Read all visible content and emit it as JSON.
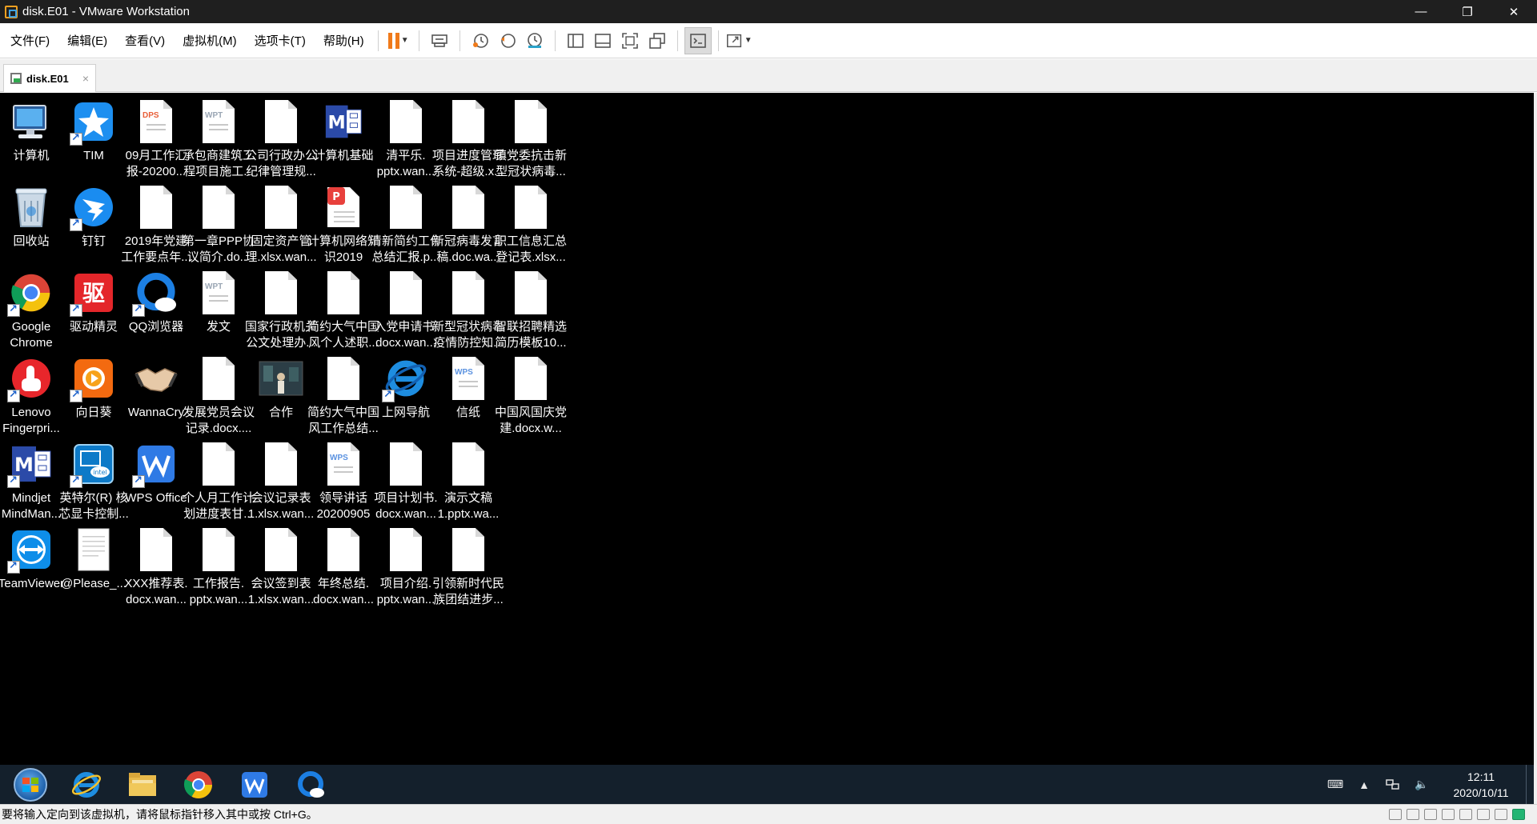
{
  "window": {
    "title": "disk.E01 - VMware Workstation",
    "controls": {
      "minimize": "—",
      "restore": "❐",
      "close": "✕"
    }
  },
  "menu": [
    {
      "label": "文件(F)"
    },
    {
      "label": "编辑(E)"
    },
    {
      "label": "查看(V)"
    },
    {
      "label": "虚拟机(M)"
    },
    {
      "label": "选项卡(T)"
    },
    {
      "label": "帮助(H)"
    }
  ],
  "tab": {
    "label": "disk.E01",
    "close": "×"
  },
  "desktop_icons": [
    {
      "label": "计算机",
      "icon": "computer-icon",
      "shortcut": false
    },
    {
      "label": "TIM",
      "icon": "tim-icon",
      "shortcut": true
    },
    {
      "label": "09月工作汇\n报-20200...",
      "icon": "dps-doc-icon",
      "shortcut": false,
      "doc_tag": "DPS"
    },
    {
      "label": "承包商建筑工\n程项目施工...",
      "icon": "wpt-doc-icon",
      "shortcut": false,
      "doc_tag": "WPT"
    },
    {
      "label": "公司行政办公\n纪律管理规...",
      "icon": "blank-doc-icon",
      "shortcut": false
    },
    {
      "label": "计算机基础",
      "icon": "mindjet-doc-icon",
      "shortcut": false
    },
    {
      "label": "清平乐.\npptx.wan...",
      "icon": "blank-doc-icon",
      "shortcut": false
    },
    {
      "label": "项目进度管理\n系统-超级.x...",
      "icon": "blank-doc-icon",
      "shortcut": false
    },
    {
      "label": "镇党委抗击新\n型冠状病毒...",
      "icon": "blank-doc-icon",
      "shortcut": false
    },
    {
      "label": "回收站",
      "icon": "recycle-bin-icon",
      "shortcut": false
    },
    {
      "label": "钉钉",
      "icon": "dingtalk-icon",
      "shortcut": true
    },
    {
      "label": "2019年党建\n工作要点年...",
      "icon": "blank-doc-icon",
      "shortcut": false
    },
    {
      "label": "第一章PPP协\n议简介.do...",
      "icon": "blank-doc-icon",
      "shortcut": false
    },
    {
      "label": "固定资产管\n理.xlsx.wan...",
      "icon": "blank-doc-icon",
      "shortcut": false
    },
    {
      "label": "计算机网络知\n识2019",
      "icon": "wps-pdf-doc-icon",
      "shortcut": false
    },
    {
      "label": "清新简约工作\n总结汇报.p...",
      "icon": "blank-doc-icon",
      "shortcut": false
    },
    {
      "label": "新冠病毒发言\n稿.doc.wa...",
      "icon": "blank-doc-icon",
      "shortcut": false
    },
    {
      "label": "职工信息汇总\n登记表.xlsx...",
      "icon": "blank-doc-icon",
      "shortcut": false
    },
    {
      "label": "Google\nChrome",
      "icon": "chrome-icon",
      "shortcut": true
    },
    {
      "label": "驱动精灵",
      "icon": "driver-genius-icon",
      "shortcut": true
    },
    {
      "label": "QQ浏览器",
      "icon": "qq-browser-icon",
      "shortcut": true
    },
    {
      "label": "发文",
      "icon": "wpt-doc-icon",
      "shortcut": false,
      "doc_tag": "WPT"
    },
    {
      "label": "国家行政机关\n公文处理办...",
      "icon": "blank-doc-icon",
      "shortcut": false
    },
    {
      "label": "简约大气中国\n风个人述职...",
      "icon": "blank-doc-icon",
      "shortcut": false
    },
    {
      "label": "入党申请书.\ndocx.wan...",
      "icon": "blank-doc-icon",
      "shortcut": false
    },
    {
      "label": "新型冠状病毒\n疫情防控知...",
      "icon": "blank-doc-icon",
      "shortcut": false
    },
    {
      "label": "智联招聘精选\n简历模板10...",
      "icon": "blank-doc-icon",
      "shortcut": false
    },
    {
      "label": "Lenovo\nFingerpri...",
      "icon": "fingerprint-icon",
      "shortcut": true
    },
    {
      "label": "向日葵",
      "icon": "sunflower-icon",
      "shortcut": true
    },
    {
      "label": "WannaCry",
      "icon": "handshake-icon",
      "shortcut": false
    },
    {
      "label": "发展党员会议\n记录.docx....",
      "icon": "blank-doc-icon",
      "shortcut": false
    },
    {
      "label": "合作",
      "icon": "photo-icon",
      "shortcut": false
    },
    {
      "label": "简约大气中国\n风工作总结...",
      "icon": "blank-doc-icon",
      "shortcut": false
    },
    {
      "label": "上网导航",
      "icon": "ie-icon",
      "shortcut": true
    },
    {
      "label": "信纸",
      "icon": "wps-doc-icon",
      "shortcut": false,
      "doc_tag": "WPS"
    },
    {
      "label": "中国风国庆党\n建.docx.w...",
      "icon": "blank-doc-icon",
      "shortcut": false
    },
    {
      "label": "Mindjet\nMindMan...",
      "icon": "mindjet-icon",
      "shortcut": true
    },
    {
      "label": "英特尔(R) 核\n芯显卡控制...",
      "icon": "intel-graphics-icon",
      "shortcut": true
    },
    {
      "label": "WPS Office",
      "icon": "wps-office-icon",
      "shortcut": true
    },
    {
      "label": "个人月工作计\n划进度表甘...",
      "icon": "blank-doc-icon",
      "shortcut": false
    },
    {
      "label": "会议记录表\n1.xlsx.wan...",
      "icon": "blank-doc-icon",
      "shortcut": false
    },
    {
      "label": "领导讲话\n20200905",
      "icon": "wps-doc-icon",
      "shortcut": false,
      "doc_tag": "WPS"
    },
    {
      "label": "项目计划书.\ndocx.wan...",
      "icon": "blank-doc-icon",
      "shortcut": false
    },
    {
      "label": "演示文稿\n1.pptx.wa...",
      "icon": "blank-doc-icon",
      "shortcut": false
    },
    {
      "label": "TeamViewer",
      "icon": "teamviewer-icon",
      "shortcut": true
    },
    {
      "label": "@Please_...",
      "icon": "text-file-icon",
      "shortcut": false
    },
    {
      "label": "XXX推荐表.\ndocx.wan...",
      "icon": "blank-doc-icon",
      "shortcut": false
    },
    {
      "label": "工作报告.\npptx.wan...",
      "icon": "blank-doc-icon",
      "shortcut": false
    },
    {
      "label": "会议签到表\n1.xlsx.wan...",
      "icon": "blank-doc-icon",
      "shortcut": false
    },
    {
      "label": "年终总结.\ndocx.wan...",
      "icon": "blank-doc-icon",
      "shortcut": false
    },
    {
      "label": "项目介绍.\npptx.wan...",
      "icon": "blank-doc-icon",
      "shortcut": false
    },
    {
      "label": "引领新时代民\n族团结进步...",
      "icon": "blank-doc-icon",
      "shortcut": false
    }
  ],
  "taskbar": {
    "pinned": [
      "start-orb",
      "ie-icon",
      "file-explorer-icon",
      "chrome-icon",
      "wps-office-icon",
      "qq-browser-icon"
    ],
    "clock_time": "12:11",
    "clock_date": "2020/10/11"
  },
  "statusbar": {
    "message": "要将输入定向到该虚拟机，请将鼠标指针移入其中或按 Ctrl+G。"
  },
  "colors": {
    "titlebar": "#1f1f1f",
    "desktop": "#000000",
    "taskbar": "#14202c",
    "accent_orange": "#f07a1a"
  }
}
